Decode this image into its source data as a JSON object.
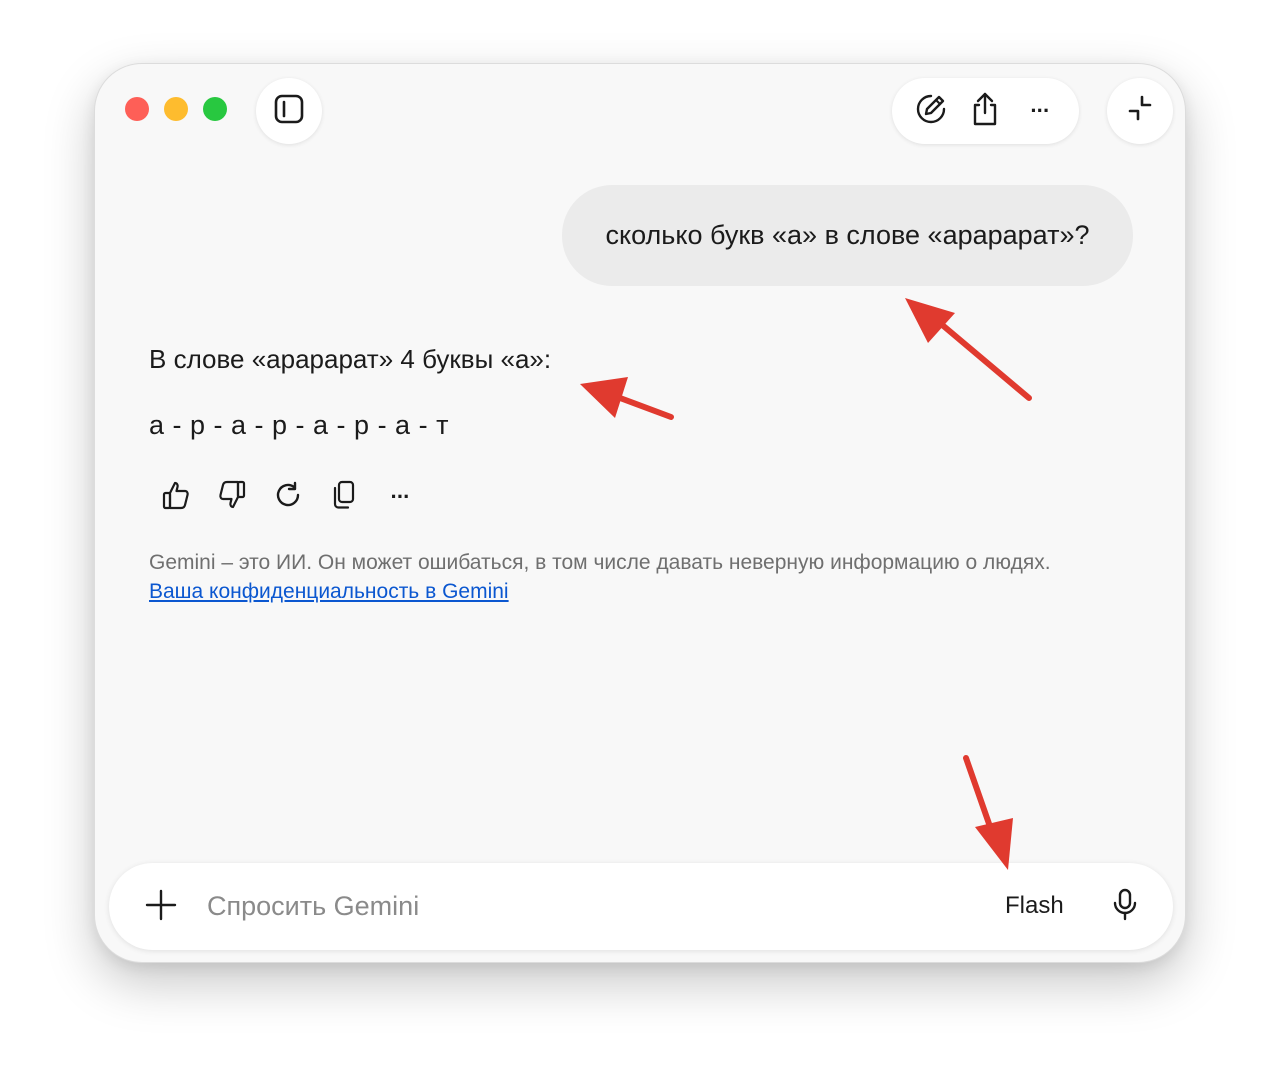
{
  "window": {
    "traffic_colors": [
      "#fe5f57",
      "#febc2e",
      "#28c840"
    ]
  },
  "toolbar": {
    "sidebar_icon": "sidebar-toggle-icon",
    "new_chat_icon": "edit-pencil-icon",
    "share_icon": "share-icon",
    "more_label": "···",
    "collapse_icon": "collapse-icon"
  },
  "conversation": {
    "user_message": "сколько букв «а» в слове «арарарат»?",
    "answer_title": "В слове «арарарат» 4 буквы «а»:",
    "answer_sequence": "а - р - а - р - а - р - а - т",
    "actions": [
      "thumbs-up-icon",
      "thumbs-down-icon",
      "regenerate-icon",
      "copy-icon",
      "more-icon"
    ],
    "more_label": "···"
  },
  "disclaimer": {
    "text": "Gemini – это ИИ. Он может ошибаться, в том числе давать неверную информацию о людях.",
    "link": "Ваша конфиденциальность в Gemini"
  },
  "input": {
    "placeholder": "Спросить Gemini",
    "model_label": "Flash"
  },
  "annotations": {
    "arrow_color": "#e03a2f"
  },
  "colors": {
    "link": "#0b57d0",
    "bubble": "#ebebeb",
    "window_bg": "#f8f8f8"
  }
}
